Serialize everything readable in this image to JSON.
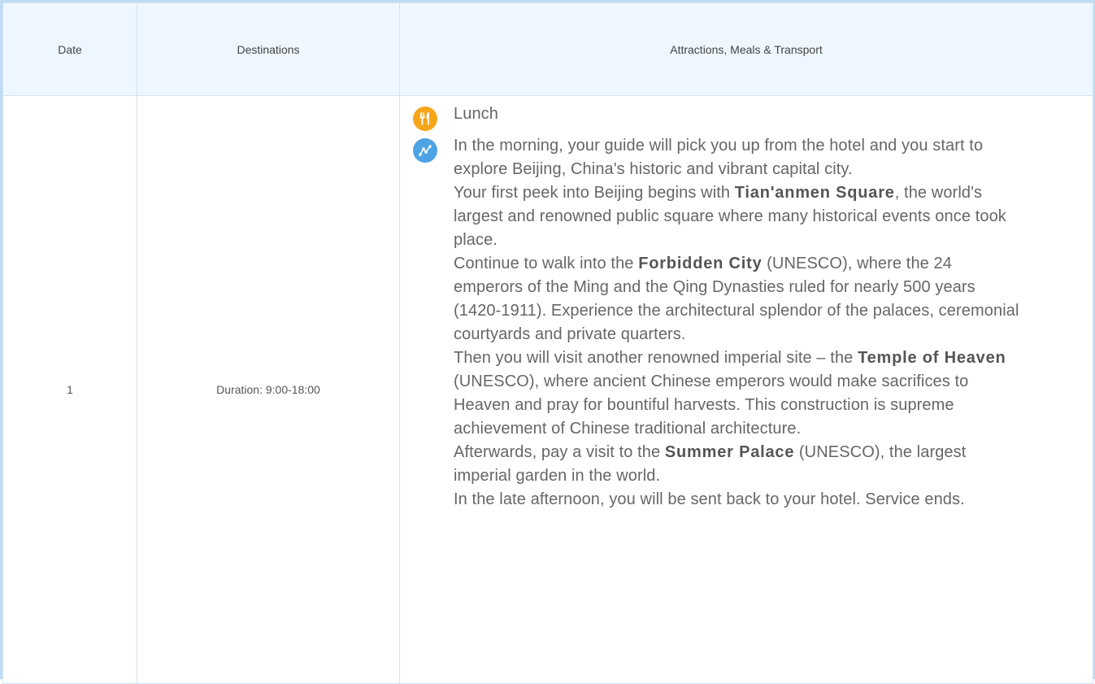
{
  "table": {
    "headers": {
      "date": "Date",
      "destinations": "Destinations",
      "attractions": "Attractions, Meals & Transport"
    },
    "row": {
      "day": "1",
      "duration": "Duration: 9:00-18:00",
      "meal": {
        "icon": "meal-icon",
        "icon_color": "#f6a51a",
        "label": "Lunch"
      },
      "route": {
        "icon": "route-icon",
        "icon_color": "#4ea3e4",
        "p1": "In the morning, your guide will pick you up from the hotel and you start to explore Beijing, China's historic and vibrant capital city.",
        "p2_pre": "Your first peek into Beijing begins with ",
        "p2_bold": "Tian'anmen Square",
        "p2_post": ", the world's largest and renowned public square where many historical events once took place.",
        "p3_pre": "Continue to walk into the ",
        "p3_bold": "Forbidden City",
        "p3_post": " (UNESCO), where the 24 emperors of the Ming and the Qing Dynasties ruled for nearly 500 years (1420-1911). Experience the architectural splendor of the palaces, ceremonial courtyards and private quarters.",
        "p4_pre": "Then you will visit another renowned imperial site – the ",
        "p4_bold": "Temple of Heaven",
        "p4_post": " (UNESCO), where ancient Chinese emperors would make sacrifices to Heaven and pray for bountiful harvests. This construction is supreme achievement of Chinese traditional architecture.",
        "p5_pre": "Afterwards, pay a visit to the ",
        "p5_bold": "Summer Palace",
        "p5_post": " (UNESCO), the largest imperial garden in the world.",
        "p6": "In the late afternoon, you will be sent back to your hotel. Service ends."
      }
    }
  },
  "colors": {
    "border": "#cfe3f4",
    "header_bg": "#eef7ff",
    "frame": "#bfdcf3"
  }
}
